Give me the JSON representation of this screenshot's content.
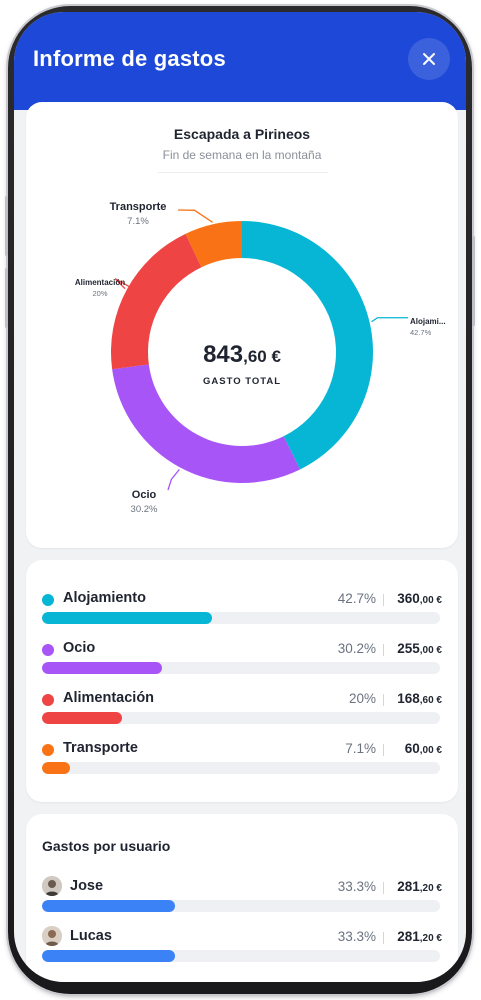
{
  "header": {
    "title": "Informe de gastos"
  },
  "summary": {
    "title": "Escapada a Pirineos",
    "subtitle": "Fin de semana en la montaña",
    "total_int": "843",
    "total_cents": ",60 €",
    "total_label": "GASTO TOTAL"
  },
  "chart_data": {
    "type": "pie",
    "variant": "donut",
    "title": "Escapada a Pirineos",
    "center_value": "843,60 €",
    "center_label": "GASTO TOTAL",
    "slices": [
      {
        "label": "Alojamiento",
        "display_label": "Alojami...",
        "pct_label": "42.7%",
        "value": 42.7,
        "color": "#06b6d4"
      },
      {
        "label": "Ocio",
        "display_label": "Ocio",
        "pct_label": "30.2%",
        "value": 30.2,
        "color": "#a855f7"
      },
      {
        "label": "Alimentación",
        "display_label": "Alimentación",
        "pct_label": "20%",
        "value": 20,
        "color": "#ef4444"
      },
      {
        "label": "Transporte",
        "display_label": "Transporte",
        "pct_label": "7.1%",
        "value": 7.1,
        "color": "#f97316"
      }
    ]
  },
  "categories": [
    {
      "name": "Alojamiento",
      "pct": "42.7%",
      "amount_int": "360",
      "amount_cents": ",00 €",
      "fraction": 0.427,
      "color": "#06b6d4"
    },
    {
      "name": "Ocio",
      "pct": "30.2%",
      "amount_int": "255",
      "amount_cents": ",00 €",
      "fraction": 0.302,
      "color": "#a855f7"
    },
    {
      "name": "Alimentación",
      "pct": "20%",
      "amount_int": "168",
      "amount_cents": ",60 €",
      "fraction": 0.2,
      "color": "#ef4444"
    },
    {
      "name": "Transporte",
      "pct": "7.1%",
      "amount_int": "60",
      "amount_cents": ",00 €",
      "fraction": 0.071,
      "color": "#f97316"
    }
  ],
  "users": {
    "title": "Gastos por usuario",
    "bar_color": "#3b82f6",
    "items": [
      {
        "name": "Jose",
        "pct": "33.3%",
        "amount_int": "281",
        "amount_cents": ",20 €",
        "fraction": 0.333
      },
      {
        "name": "Lucas",
        "pct": "33.3%",
        "amount_int": "281",
        "amount_cents": ",20 €",
        "fraction": 0.333
      }
    ]
  },
  "icons": {
    "close": "close-icon",
    "user": "avatar"
  },
  "colors": {
    "header": "#1d48d8",
    "screen_bg": "#f1f2f4"
  }
}
